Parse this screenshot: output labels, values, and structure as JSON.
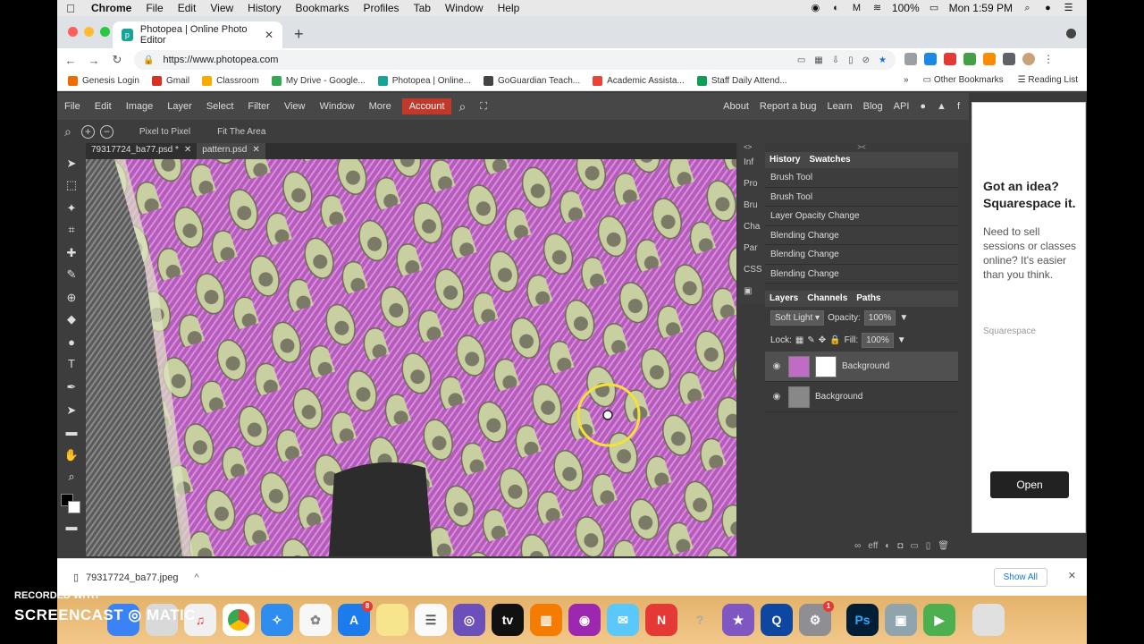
{
  "menubar": {
    "app": "Chrome",
    "items": [
      "File",
      "Edit",
      "View",
      "History",
      "Bookmarks",
      "Profiles",
      "Tab",
      "Window",
      "Help"
    ],
    "battery": "100%",
    "clock": "Mon 1:59 PM"
  },
  "browser": {
    "tab_title": "Photopea | Online Photo Editor",
    "url": "https://www.photopea.com",
    "bookmarks": [
      "Genesis Login",
      "Gmail",
      "Classroom",
      "My Drive - Google...",
      "Photopea | Online...",
      "GoGuardian Teach...",
      "Academic Assista...",
      "Staff Daily Attend..."
    ],
    "bookmarks_more": "»",
    "other_bookmarks": "Other Bookmarks",
    "reading_list": "Reading List"
  },
  "photopea": {
    "menu": [
      "File",
      "Edit",
      "Image",
      "Layer",
      "Select",
      "Filter",
      "View",
      "Window",
      "More"
    ],
    "account": "Account",
    "menu_right": [
      "About",
      "Report a bug",
      "Learn",
      "Blog",
      "API"
    ],
    "options": {
      "pixel_to_pixel": "Pixel to Pixel",
      "fit_area": "Fit The Area"
    },
    "doc_tabs": [
      {
        "name": "79317724_ba77.psd *"
      },
      {
        "name": "pattern.psd"
      }
    ],
    "mini_panels": [
      "Inf",
      "Pro",
      "Bru",
      "Cha",
      "Par",
      "CSS"
    ],
    "history_tabs": [
      "History",
      "Swatches"
    ],
    "history": [
      "Brush Tool",
      "Brush Tool",
      "Layer Opacity Change",
      "Blending Change",
      "Blending Change",
      "Blending Change"
    ],
    "layers_tabs": [
      "Layers",
      "Channels",
      "Paths"
    ],
    "blend_mode": "Soft Light",
    "opacity_label": "Opacity:",
    "opacity": "100%",
    "lock_label": "Lock:",
    "fill_label": "Fill:",
    "fill": "100%",
    "layers": [
      {
        "name": "Background",
        "active": true
      },
      {
        "name": "Background",
        "active": false
      }
    ],
    "layer_footer": "eff"
  },
  "ad": {
    "headline": "Got an idea? Squarespace it.",
    "body": "Need to sell sessions or classes online? It's easier than you think.",
    "brand": "Squarespace",
    "cta": "Open"
  },
  "download_bar": {
    "file": "79317724_ba77.jpeg",
    "show_all": "Show All"
  },
  "watermark": {
    "line1": "RECORDED WITH",
    "line2": "SCREENCAST",
    "line2b": "MATIC"
  },
  "dock": {
    "ps_label": "Ps",
    "tv_label": "tv",
    "badge1": "8",
    "badge2": "1"
  }
}
